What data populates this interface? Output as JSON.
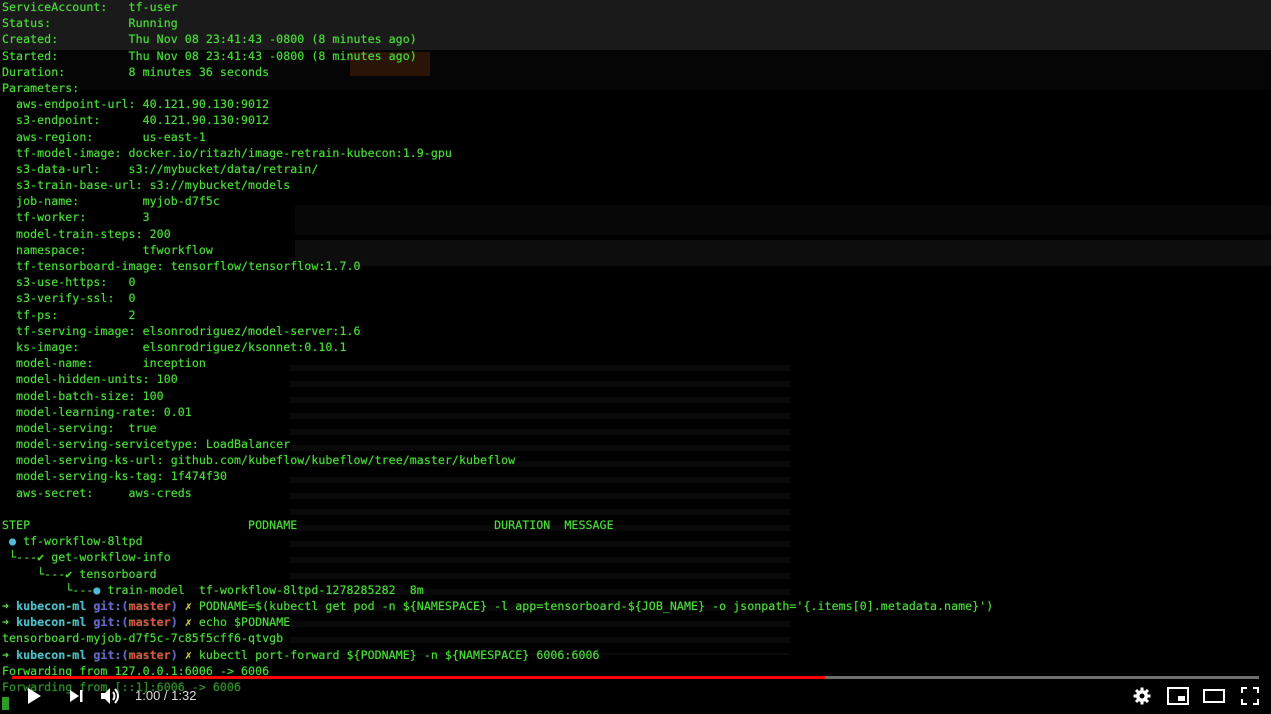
{
  "terminal": {
    "header": [
      {
        "key": "ServiceAccount:",
        "pad": "   ",
        "value": "tf-user"
      },
      {
        "key": "Status:",
        "pad": "           ",
        "value": "Running"
      },
      {
        "key": "Created:",
        "pad": "          ",
        "value": "Thu Nov 08 23:41:43 -0800 (8 minutes ago)"
      },
      {
        "key": "Started:",
        "pad": "          ",
        "value": "Thu Nov 08 23:41:43 -0800 (8 minutes ago)"
      },
      {
        "key": "Duration:",
        "pad": "         ",
        "value": "8 minutes 36 seconds"
      },
      {
        "key": "Parameters:",
        "pad": "",
        "value": ""
      }
    ],
    "parameters": [
      {
        "key": "aws-endpoint-url:",
        "pad": " ",
        "value": "40.121.90.130:9012"
      },
      {
        "key": "s3-endpoint:",
        "pad": "      ",
        "value": "40.121.90.130:9012"
      },
      {
        "key": "aws-region:",
        "pad": "       ",
        "value": "us-east-1"
      },
      {
        "key": "tf-model-image:",
        "pad": " ",
        "value": "docker.io/ritazh/image-retrain-kubecon:1.9-gpu"
      },
      {
        "key": "s3-data-url:",
        "pad": "    ",
        "value": "s3://mybucket/data/retrain/"
      },
      {
        "key": "s3-train-base-url:",
        "pad": " ",
        "value": "s3://mybucket/models"
      },
      {
        "key": "job-name:",
        "pad": "         ",
        "value": "myjob-d7f5c"
      },
      {
        "key": "tf-worker:",
        "pad": "        ",
        "value": "3"
      },
      {
        "key": "model-train-steps:",
        "pad": " ",
        "value": "200"
      },
      {
        "key": "namespace:",
        "pad": "        ",
        "value": "tfworkflow"
      },
      {
        "key": "tf-tensorboard-image:",
        "pad": " ",
        "value": "tensorflow/tensorflow:1.7.0"
      },
      {
        "key": "s3-use-https:",
        "pad": "   ",
        "value": "0"
      },
      {
        "key": "s3-verify-ssl:",
        "pad": "  ",
        "value": "0"
      },
      {
        "key": "tf-ps:",
        "pad": "          ",
        "value": "2"
      },
      {
        "key": "tf-serving-image:",
        "pad": " ",
        "value": "elsonrodriguez/model-server:1.6"
      },
      {
        "key": "ks-image:",
        "pad": "         ",
        "value": "elsonrodriguez/ksonnet:0.10.1"
      },
      {
        "key": "model-name:",
        "pad": "       ",
        "value": "inception"
      },
      {
        "key": "model-hidden-units:",
        "pad": " ",
        "value": "100"
      },
      {
        "key": "model-batch-size:",
        "pad": " ",
        "value": "100"
      },
      {
        "key": "model-learning-rate:",
        "pad": " ",
        "value": "0.01"
      },
      {
        "key": "model-serving:",
        "pad": "  ",
        "value": "true"
      },
      {
        "key": "model-serving-servicetype:",
        "pad": " ",
        "value": "LoadBalancer"
      },
      {
        "key": "model-serving-ks-url:",
        "pad": " ",
        "value": "github.com/kubeflow/kubeflow/tree/master/kubeflow"
      },
      {
        "key": "model-serving-ks-tag:",
        "pad": " ",
        "value": "1f474f30"
      },
      {
        "key": "aws-secret:",
        "pad": "     ",
        "value": "aws-creds"
      }
    ],
    "steps_header": "STEP                               PODNAME                            DURATION  MESSAGE",
    "steps": [
      {
        "prefix": " ",
        "icon": "●",
        "icon_kind": "running",
        "name": "tf-workflow-8ltpd",
        "rest": ""
      },
      {
        "prefix": " └---",
        "icon": "✔",
        "icon_kind": "done",
        "name": "get-workflow-info",
        "rest": ""
      },
      {
        "prefix": "     └---",
        "icon": "✔",
        "icon_kind": "done",
        "name": "tensorboard",
        "rest": ""
      },
      {
        "prefix": "         └---",
        "icon": "●",
        "icon_kind": "running",
        "name": "train-model",
        "rest": "  tf-workflow-8ltpd-1278285282  8m"
      }
    ],
    "prompt": {
      "arrow": "➜",
      "dir": "kubecon-ml",
      "git": "git:(",
      "branch": "master",
      "git_close": ")",
      "dirty": "✗"
    },
    "commands": [
      {
        "type": "cmd",
        "text": "PODNAME=$(kubectl get pod -n ${NAMESPACE} -l app=tensorboard-${JOB_NAME} -o jsonpath='{.items[0].metadata.name}')"
      },
      {
        "type": "cmd",
        "text": "echo $PODNAME"
      },
      {
        "type": "out",
        "text": "tensorboard-myjob-d7f5c-7c85f5cff6-qtvgb"
      },
      {
        "type": "cmd",
        "text": "kubectl port-forward ${PODNAME} -n ${NAMESPACE} 6006:6006"
      },
      {
        "type": "out",
        "text": "Forwarding from 127.0.0.1:6006 -> 6006"
      },
      {
        "type": "out-dim",
        "text": "Forwarding from [::1]:6006 -> 6006"
      }
    ]
  },
  "player": {
    "current_time": "1:00",
    "duration": "1:32",
    "time_display": "1:00 / 1:32",
    "progress_fraction": 0.652,
    "accent_color": "#ff0000",
    "controls": [
      "play-icon",
      "next-icon",
      "volume-icon",
      "settings-icon",
      "miniplayer-icon",
      "theater-mode-icon",
      "fullscreen-icon"
    ]
  }
}
